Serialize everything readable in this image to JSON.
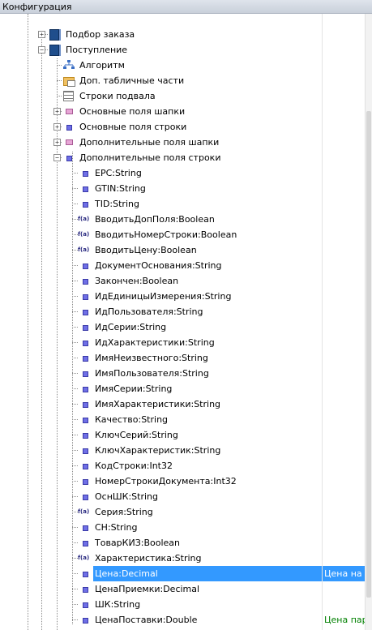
{
  "window": {
    "title": "Конфигурация"
  },
  "tree": {
    "nodes": [
      {
        "label": "Подбор заказа",
        "icon": "book-icon",
        "expander": "+"
      },
      {
        "label": "Поступление",
        "icon": "book-icon",
        "expander": "−"
      },
      {
        "label": "Алгоритм",
        "icon": "algorithm-icon"
      },
      {
        "label": "Доп. табличные части",
        "icon": "folder-table-icon"
      },
      {
        "label": "Строки подвала",
        "icon": "table-icon"
      },
      {
        "label": "Основные поля шапки",
        "icon": "pink-field-icon",
        "expander": "+"
      },
      {
        "label": "Основные поля строки",
        "icon": "property-icon",
        "expander": "+"
      },
      {
        "label": "Дополнительные поля шапки",
        "icon": "pink-field-icon",
        "expander": "+"
      },
      {
        "label": "Дополнительные поля строки",
        "icon": "property-icon",
        "expander": "−"
      },
      {
        "label": "EPC:String",
        "icon": "property-icon"
      },
      {
        "label": "GTIN:String",
        "icon": "property-icon"
      },
      {
        "label": "TID:String",
        "icon": "property-icon"
      },
      {
        "label": "ВводитьДопПоля:Boolean",
        "icon": "function-icon",
        "icon_text": "f(a)"
      },
      {
        "label": "ВводитьНомерСтроки:Boolean",
        "icon": "function-icon",
        "icon_text": "f(a)"
      },
      {
        "label": "ВводитьЦену:Boolean",
        "icon": "function-icon",
        "icon_text": "f(a)"
      },
      {
        "label": "ДокументОснования:String",
        "icon": "property-icon"
      },
      {
        "label": "Закончен:Boolean",
        "icon": "property-icon"
      },
      {
        "label": "ИдЕдиницыИзмерения:String",
        "icon": "property-icon"
      },
      {
        "label": "ИдПользователя:String",
        "icon": "property-icon"
      },
      {
        "label": "ИдСерии:String",
        "icon": "property-icon"
      },
      {
        "label": "ИдХарактеристики:String",
        "icon": "property-icon"
      },
      {
        "label": "ИмяНеизвестного:String",
        "icon": "property-icon"
      },
      {
        "label": "ИмяПользователя:String",
        "icon": "property-icon"
      },
      {
        "label": "ИмяСерии:String",
        "icon": "property-icon"
      },
      {
        "label": "ИмяХарактеристики:String",
        "icon": "property-icon"
      },
      {
        "label": "Качество:String",
        "icon": "property-icon"
      },
      {
        "label": "КлючСерий:String",
        "icon": "property-icon"
      },
      {
        "label": "КлючХарактеристик:String",
        "icon": "property-icon"
      },
      {
        "label": "КодСтроки:Int32",
        "icon": "property-icon"
      },
      {
        "label": "НомерСтрокиДокумента:Int32",
        "icon": "property-icon"
      },
      {
        "label": "ОснШК:String",
        "icon": "property-icon"
      },
      {
        "label": "Серия:String",
        "icon": "function-icon",
        "icon_text": "f(a)"
      },
      {
        "label": "СН:String",
        "icon": "property-icon"
      },
      {
        "label": "ТоварКИЗ:Boolean",
        "icon": "property-icon"
      },
      {
        "label": "Характеристика:String",
        "icon": "function-icon",
        "icon_text": "f(a)"
      },
      {
        "label": "Цена:Decimal",
        "icon": "property-icon",
        "selected": true,
        "right": "Цена на с"
      },
      {
        "label": "ЦенаПриемки:Decimal",
        "icon": "property-icon"
      },
      {
        "label": "ШК:String",
        "icon": "property-icon"
      },
      {
        "label": "ЦенаПоставки:Double",
        "icon": "property-icon",
        "right": "Цена пар"
      }
    ]
  },
  "colors": {
    "selection": "#3399ff",
    "right_text_green": "#008000"
  }
}
